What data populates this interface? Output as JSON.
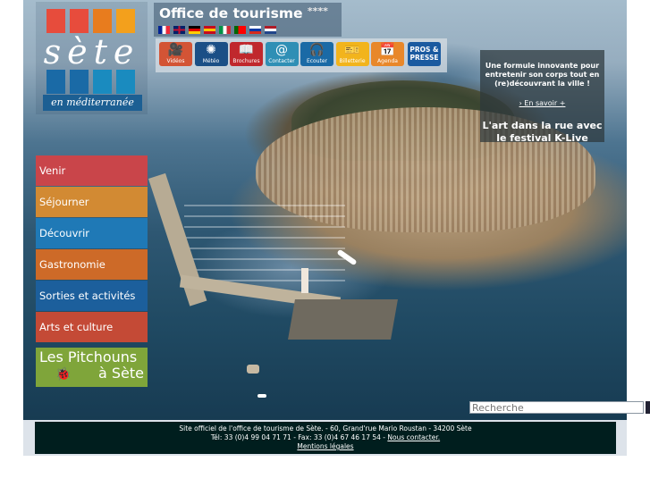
{
  "header": {
    "logo": {
      "script_text": "sète",
      "tagline": "en méditerranée",
      "squares": [
        "#e74c3c",
        "#e74c3c",
        "#e87c1e",
        "#f3a01c",
        "#1a6aa6",
        "#1a6aa6",
        "#1a8bbf",
        "#1a8bbf"
      ]
    },
    "title": "Office de tourisme",
    "stars": "****",
    "flags": [
      {
        "name": "france-flag",
        "colors": [
          "#002395",
          "#ffffff",
          "#ed2939"
        ],
        "dir": "v"
      },
      {
        "name": "uk-flag",
        "colors": [
          "#012169",
          "#c8102e",
          "#ffffff"
        ],
        "dir": "uk"
      },
      {
        "name": "germany-flag",
        "colors": [
          "#000000",
          "#dd0000",
          "#ffce00"
        ],
        "dir": "h"
      },
      {
        "name": "spain-flag",
        "colors": [
          "#c60b1e",
          "#ffc400",
          "#c60b1e"
        ],
        "dir": "h"
      },
      {
        "name": "italy-flag",
        "colors": [
          "#009246",
          "#ffffff",
          "#ce2b37"
        ],
        "dir": "v"
      },
      {
        "name": "portugal-flag",
        "colors": [
          "#006600",
          "#ff0000",
          "#ff0000"
        ],
        "dir": "v"
      },
      {
        "name": "russia-flag",
        "colors": [
          "#ffffff",
          "#0039a6",
          "#d52b1e"
        ],
        "dir": "h"
      },
      {
        "name": "netherlands-flag",
        "colors": [
          "#ae1c28",
          "#ffffff",
          "#21468b"
        ],
        "dir": "h"
      }
    ]
  },
  "toolbar": {
    "buttons": [
      {
        "label": "Vidéos",
        "icon": "video-camera-icon",
        "glyph": "🎥",
        "color": "#d35435"
      },
      {
        "label": "Météo",
        "icon": "sun-icon",
        "glyph": "✺",
        "color": "#1b4f86"
      },
      {
        "label": "Brochures",
        "icon": "brochure-icon",
        "glyph": "📖",
        "color": "#c0282d"
      },
      {
        "label": "Contacter",
        "icon": "at-icon",
        "glyph": "@",
        "color": "#2f8fb5"
      },
      {
        "label": "Ecouter",
        "icon": "headphones-icon",
        "glyph": "🎧",
        "color": "#1a6aa6"
      },
      {
        "label": "Billetterie",
        "icon": "ticket-icon",
        "glyph": "🎫",
        "color": "#f2b41c"
      },
      {
        "label": "Agenda",
        "icon": "calendar-icon",
        "glyph": "📅",
        "color": "#e8872a"
      }
    ],
    "pros": {
      "label": "PROS & PRESSE",
      "color": "#1a5aa0"
    }
  },
  "promo": {
    "text": "Une formule innovante pour entretenir son corps tout en (re)découvrant la ville !",
    "link": "› En savoir +",
    "headline": "L'art dans la rue avec le festival K-Live"
  },
  "nav": {
    "items": [
      {
        "label": "Venir",
        "color": "#c9454a"
      },
      {
        "label": "Séjourner",
        "color": "#d28a33"
      },
      {
        "label": "Découvrir",
        "color": "#1f79b6"
      },
      {
        "label": "Gastronomie",
        "color": "#cd6a28"
      },
      {
        "label": "Sorties et activités",
        "color": "#1c5f9c"
      },
      {
        "label": "Arts et culture",
        "color": "#c44a36"
      }
    ],
    "pitchouns": {
      "line1": "Les Pitchouns",
      "line2": "à Sète"
    }
  },
  "search": {
    "placeholder": "Recherche"
  },
  "footer": {
    "line1": "Site officiel de l'office de tourisme de Sète. - 60, Grand'rue Mario Roustan - 34200 Sète",
    "line2": "Tél: 33 (0)4 99 04 71 71 - Fax: 33 (0)4 67 46 17 54 - ",
    "contact_link": "Nous contacter.",
    "mentions_link": "Mentions légales"
  }
}
